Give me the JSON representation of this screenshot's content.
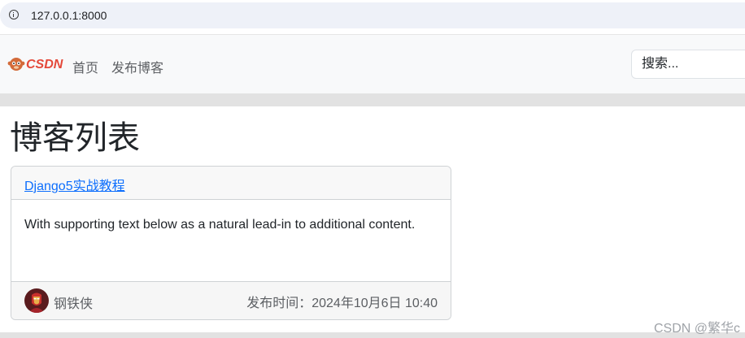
{
  "browser": {
    "url": "127.0.0.1:8000",
    "icon": "info-icon"
  },
  "navbar": {
    "brand": "CSDN",
    "links": [
      "首页",
      "发布博客"
    ],
    "search_placeholder": "搜索..."
  },
  "page": {
    "title": "博客列表"
  },
  "posts": [
    {
      "title": "Django5实战教程",
      "body": "With supporting text below as a natural lead-in to additional content.",
      "author": "钢铁侠",
      "time_label": "发布时间：",
      "time_value": "2024年10月6日 10:40"
    }
  ],
  "watermark": "CSDN @繁华c",
  "colors": {
    "link": "#0d6efd",
    "logo_red": "#e4493a"
  }
}
